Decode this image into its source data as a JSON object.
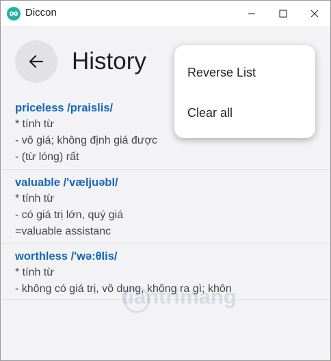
{
  "window": {
    "title": "Diccon"
  },
  "header": {
    "title": "History"
  },
  "menu": {
    "items": [
      "Reverse List",
      "Clear all"
    ]
  },
  "entries": [
    {
      "word": "priceless /praislis/",
      "lines": [
        "*  tính từ",
        "- vô giá; không định giá được",
        "- (từ lóng) rất"
      ]
    },
    {
      "word": "valuable /'væljuəbl/",
      "lines": [
        "*  tính từ",
        "- có giá trị lớn, quý giá",
        "=valuable assistanc"
      ]
    },
    {
      "word": "worthless /'wə:θlis/",
      "lines": [
        "*  tính từ",
        "- không có giá trị, vô dụng, không ra gì; khôn"
      ]
    }
  ],
  "watermark": {
    "text": "uantrimang"
  },
  "colors": {
    "accent": "#1466b8",
    "app_icon": "#21b3a4"
  }
}
